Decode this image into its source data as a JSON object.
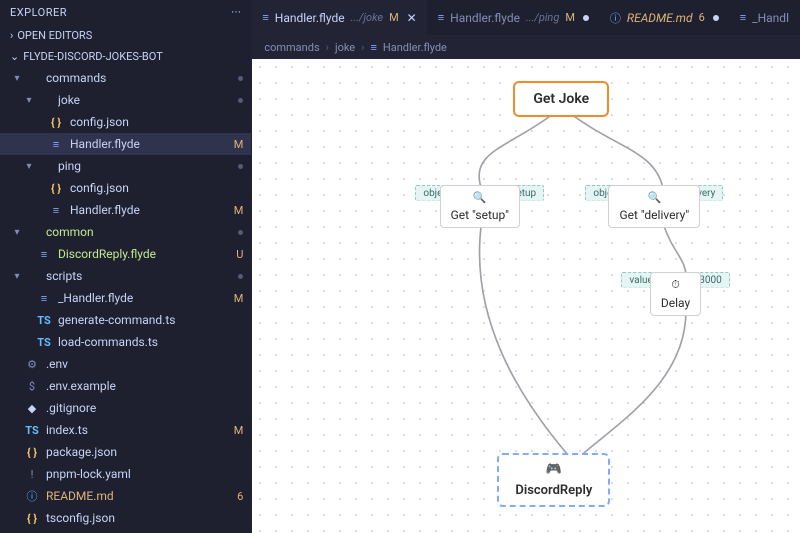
{
  "sidebar": {
    "title": "EXPLORER",
    "open_editors": "OPEN EDITORS",
    "project": "FLYDE-DISCORD-JOKES-BOT",
    "tree": [
      {
        "label": "commands",
        "icon": "folder",
        "chev": "▾",
        "depth": 0,
        "badge": "dot"
      },
      {
        "label": "joke",
        "icon": "folder",
        "chev": "▾",
        "depth": 1,
        "badge": "dot"
      },
      {
        "label": "config.json",
        "icon": "json",
        "depth": 2
      },
      {
        "label": "Handler.flyde",
        "icon": "flyde",
        "depth": 2,
        "badge": "M",
        "active": true
      },
      {
        "label": "ping",
        "icon": "folder",
        "chev": "▾",
        "depth": 1,
        "badge": "dot"
      },
      {
        "label": "config.json",
        "icon": "json",
        "depth": 2
      },
      {
        "label": "Handler.flyde",
        "icon": "flyde",
        "depth": 2,
        "badge": "M"
      },
      {
        "label": "common",
        "icon": "folder",
        "chev": "▾",
        "depth": 0,
        "badge": "dot",
        "tint": "U"
      },
      {
        "label": "DiscordReply.flyde",
        "icon": "flyde",
        "depth": 1,
        "badge": "U",
        "tint": "U"
      },
      {
        "label": "scripts",
        "icon": "folder",
        "chev": "▾",
        "depth": 0,
        "badge": "dot"
      },
      {
        "label": "_Handler.flyde",
        "icon": "flyde",
        "depth": 1,
        "badge": "M"
      },
      {
        "label": "generate-command.ts",
        "icon": "ts",
        "depth": 1
      },
      {
        "label": "load-commands.ts",
        "icon": "ts",
        "depth": 1
      },
      {
        "label": ".env",
        "icon": "gear",
        "depth": 0
      },
      {
        "label": ".env.example",
        "icon": "dollar",
        "depth": 0
      },
      {
        "label": ".gitignore",
        "icon": "git",
        "depth": 0
      },
      {
        "label": "index.ts",
        "icon": "ts",
        "depth": 0,
        "badge": "M"
      },
      {
        "label": "package.json",
        "icon": "json",
        "depth": 0
      },
      {
        "label": "pnpm-lock.yaml",
        "icon": "lock",
        "depth": 0
      },
      {
        "label": "README.md",
        "icon": "info",
        "depth": 0,
        "badge": "6",
        "tint": "M"
      },
      {
        "label": "tsconfig.json",
        "icon": "json",
        "depth": 0
      }
    ]
  },
  "tabs": [
    {
      "icon": "flyde",
      "name": "Handler.flyde",
      "hint": ".../joke",
      "badge": "M",
      "active": true,
      "close": true
    },
    {
      "icon": "flyde",
      "name": "Handler.flyde",
      "hint": ".../ping",
      "badge": "M",
      "dot": true
    },
    {
      "icon": "info",
      "name": "README.md",
      "badge": "6",
      "readme": true,
      "dot": true
    },
    {
      "icon": "flyde",
      "name": "_Handl",
      "truncated": true
    }
  ],
  "breadcrumb": [
    "commands",
    "joke",
    "Handler.flyde"
  ],
  "canvas": {
    "nodes": {
      "getJoke": {
        "label": "Get Joke"
      },
      "getSetup": {
        "pins": [
          {
            "t": "object"
          },
          {
            "t": "attribute :setup"
          }
        ],
        "label": "Get \"setup\"",
        "icon": "🔍"
      },
      "getDelivery": {
        "pins": [
          {
            "t": "object"
          },
          {
            "t": "attribute :delivery"
          }
        ],
        "label": "Get \"delivery\"",
        "icon": "🔍"
      },
      "delay": {
        "pins": [
          {
            "t": "value"
          },
          {
            "t": "delay :3000"
          }
        ],
        "label": "Delay",
        "icon": "⏱"
      },
      "reply": {
        "label": "DiscordReply",
        "icon": "🎮"
      }
    }
  }
}
